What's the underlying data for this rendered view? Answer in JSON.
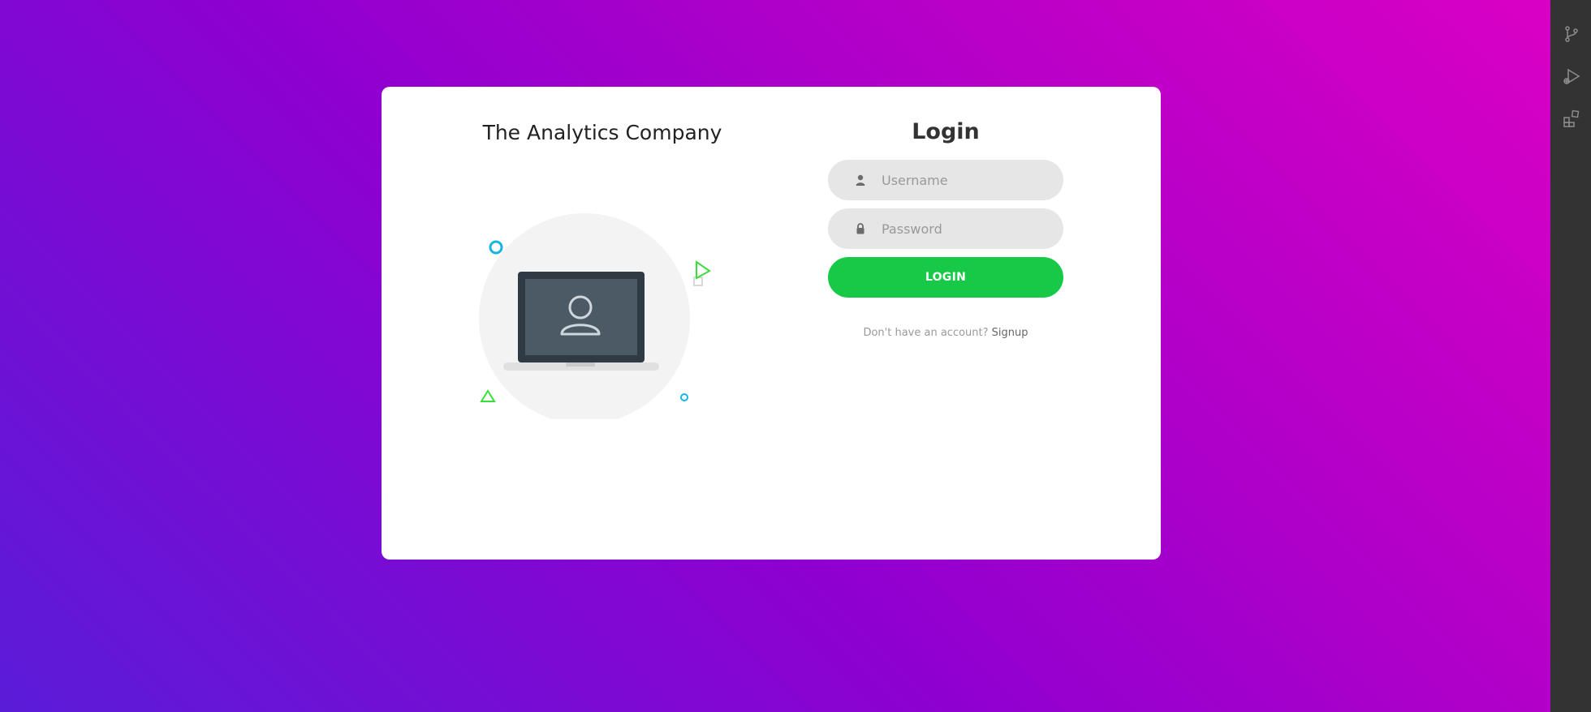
{
  "brand": {
    "title": "The Analytics Company"
  },
  "login": {
    "title": "Login",
    "username_placeholder": "Username",
    "password_placeholder": "Password",
    "button_label": "LOGIN",
    "signup_prompt": "Don't have an account?",
    "signup_link": "Signup"
  },
  "icons": {
    "username": "user-icon",
    "password": "lock-icon",
    "activity_bar": [
      "source-control-icon",
      "run-debug-icon",
      "extensions-icon"
    ]
  },
  "colors": {
    "gradient_start": "#dc00c4",
    "gradient_end": "#5a1cd8",
    "button": "#18c948",
    "card": "#ffffff",
    "input_bg": "#e6e6e6",
    "accent_cyan": "#16b4e0",
    "accent_green": "#3adf3a"
  }
}
